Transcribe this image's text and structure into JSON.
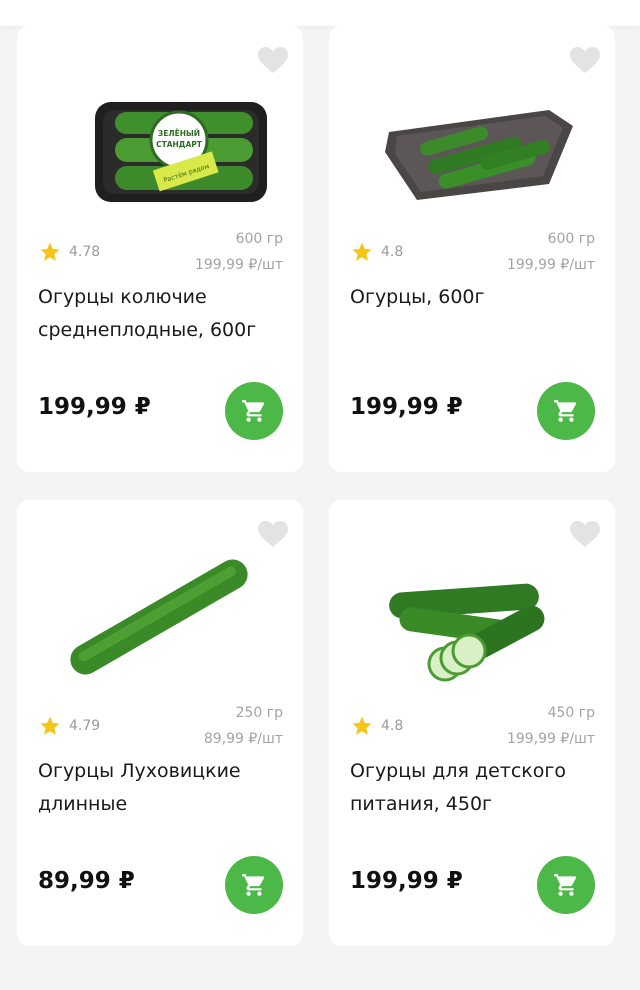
{
  "accent_color": "#4cb847",
  "star_color": "#f5c518",
  "products": [
    {
      "image": "cucumbers-in-branded-tray",
      "rating": "4.78",
      "weight": "600 гр",
      "unit_price": "199,99 ₽/шт",
      "title": "Огурцы колючие среднеплодные, 600г",
      "price": "199,99 ₽"
    },
    {
      "image": "cucumbers-in-dark-tray",
      "rating": "4.8",
      "weight": "600 гр",
      "unit_price": "199,99 ₽/шт",
      "title": "Огурцы, 600г",
      "price": "199,99 ₽"
    },
    {
      "image": "long-cucumber",
      "rating": "4.79",
      "weight": "250 гр",
      "unit_price": "89,99 ₽/шт",
      "title": "Огурцы Луховицкие длинные",
      "price": "89,99 ₽"
    },
    {
      "image": "baby-cucumbers-sliced",
      "rating": "4.8",
      "weight": "450 гр",
      "unit_price": "199,99 ₽/шт",
      "title": "Огурцы для детского питания, 450г",
      "price": "199,99 ₽"
    }
  ],
  "tray_label": {
    "brand_line1": "ЗЕЛЁНЫЙ",
    "brand_line2": "СТАНДАРТ",
    "sticker": "Растём рядом"
  }
}
